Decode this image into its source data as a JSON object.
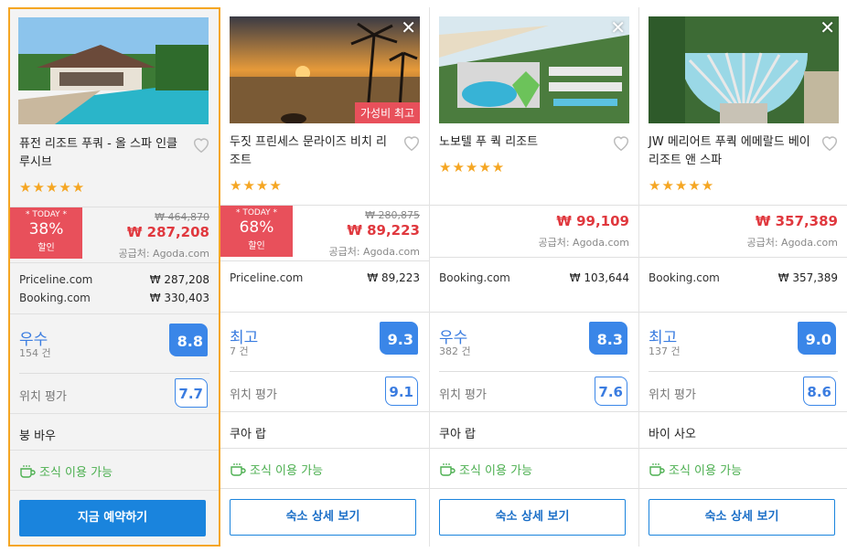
{
  "hotels": [
    {
      "name": "퓨전 리조트 푸쿼 - 올 스파 인클루시브",
      "stars": "★★★★★",
      "deal": {
        "today": "* TODAY *",
        "percent": "38%",
        "off": "할인"
      },
      "old_price": "₩ 464,870",
      "price": "₩ 287,208",
      "supplier": "공급처: Agoda.com",
      "other_prices": [
        {
          "site": "Priceline.com",
          "price": "₩ 287,208"
        },
        {
          "site": "Booking.com",
          "price": "₩ 330,403"
        }
      ],
      "rating_word": "우수",
      "review_count": "154 건",
      "score": "8.8",
      "location_label": "위치 평가",
      "location_score": "7.7",
      "area": "붕 바우",
      "breakfast": "조식 이용 가능",
      "button": "지금 예약하기"
    },
    {
      "name": "두짓 프린세스 문라이즈 비치 리조트",
      "stars": "★★★★",
      "badge": "가성비 최고",
      "deal": {
        "today": "* TODAY *",
        "percent": "68%",
        "off": "할인"
      },
      "old_price": "₩ 280,875",
      "price": "₩ 89,223",
      "supplier": "공급처: Agoda.com",
      "other_prices": [
        {
          "site": "Priceline.com",
          "price": "₩ 89,223"
        }
      ],
      "rating_word": "최고",
      "review_count": "7 건",
      "score": "9.3",
      "location_label": "위치 평가",
      "location_score": "9.1",
      "area": "쿠아 랍",
      "breakfast": "조식 이용 가능",
      "button": "숙소 상세 보기"
    },
    {
      "name": "노보텔 푸 쿽 리조트",
      "stars": "★★★★★",
      "price": "₩ 99,109",
      "supplier": "공급처: Agoda.com",
      "other_prices": [
        {
          "site": "Booking.com",
          "price": "₩ 103,644"
        }
      ],
      "rating_word": "우수",
      "review_count": "382 건",
      "score": "8.3",
      "location_label": "위치 평가",
      "location_score": "7.6",
      "area": "쿠아 랍",
      "breakfast": "조식 이용 가능",
      "button": "숙소 상세 보기"
    },
    {
      "name": "JW 메리어트 푸쿽 에메랄드 베이 리조트 앤 스파",
      "stars": "★★★★★",
      "price": "₩ 357,389",
      "supplier": "공급처: Agoda.com",
      "other_prices": [
        {
          "site": "Booking.com",
          "price": "₩ 357,389"
        }
      ],
      "rating_word": "최고",
      "review_count": "137 건",
      "score": "9.0",
      "location_label": "위치 평가",
      "location_score": "8.6",
      "area": "바이 사오",
      "breakfast": "조식 이용 가능",
      "button": "숙소 상세 보기"
    }
  ],
  "colors": {
    "accent": "#1a84dd",
    "deal": "#e8505b",
    "star": "#f5a623",
    "rating": "#3a86e8",
    "breakfast": "#4caf50",
    "selected_border": "#f5a623"
  }
}
